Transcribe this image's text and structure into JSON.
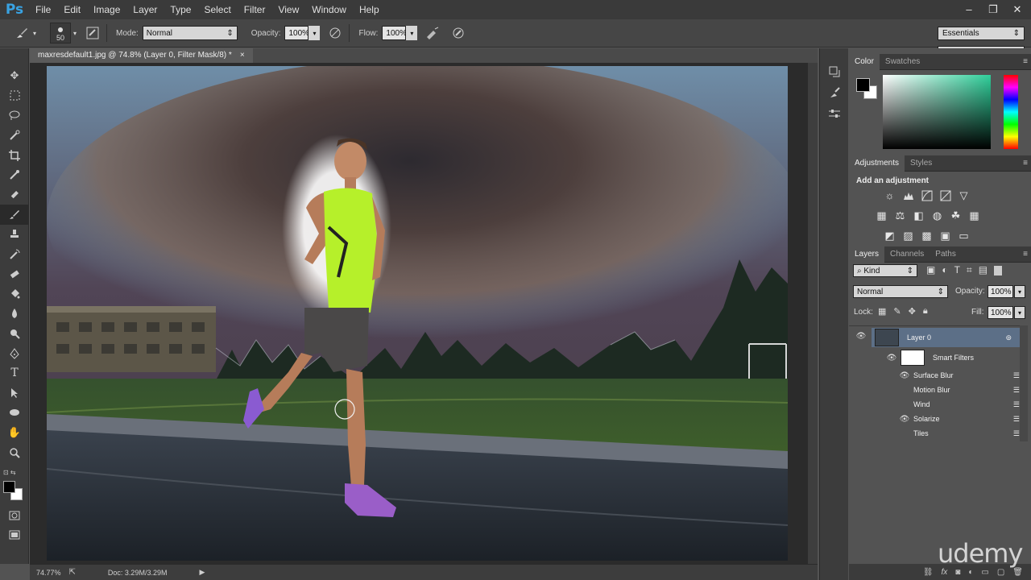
{
  "app": {
    "logo": "Ps"
  },
  "menu": [
    "File",
    "Edit",
    "Image",
    "Layer",
    "Type",
    "Select",
    "Filter",
    "View",
    "Window",
    "Help"
  ],
  "window_controls": [
    "–",
    "❐",
    "✕"
  ],
  "options": {
    "brush_size": "50",
    "mode_label": "Mode:",
    "mode_value": "Normal",
    "opacity_label": "Opacity:",
    "opacity_value": "100%",
    "flow_label": "Flow:",
    "flow_value": "100%",
    "workspace": "Essentials"
  },
  "document": {
    "tab_title": "maxresdefault1.jpg @ 74.8% (Layer 0, Filter Mask/8) *",
    "close": "×"
  },
  "status": {
    "zoom": "74.77%",
    "doc": "Doc: 3.29M/3.29M"
  },
  "color_panel": {
    "tabs": [
      "Color",
      "Swatches"
    ],
    "foreground": "#000000",
    "background": "#ffffff"
  },
  "adjustments_panel": {
    "tabs": [
      "Adjustments",
      "Styles"
    ],
    "heading": "Add an adjustment"
  },
  "layers_panel": {
    "tabs": [
      "Layers",
      "Channels",
      "Paths"
    ],
    "filter_kind": "Kind",
    "blend_mode": "Normal",
    "opacity_label": "Opacity:",
    "opacity_value": "100%",
    "lock_label": "Lock:",
    "fill_label": "Fill:",
    "fill_value": "100%",
    "layer_name": "Layer 0",
    "smart_filters_label": "Smart Filters",
    "filters": [
      {
        "name": "Surface Blur",
        "visible": true
      },
      {
        "name": "Motion Blur",
        "visible": false
      },
      {
        "name": "Wind",
        "visible": false
      },
      {
        "name": "Solarize",
        "visible": true
      },
      {
        "name": "Tiles",
        "visible": false
      }
    ]
  },
  "watermark": "udemy",
  "colors": {
    "accent": "#39a3e3",
    "selected_layer": "#5c6f87",
    "runner_shirt": "#b6f02a"
  }
}
